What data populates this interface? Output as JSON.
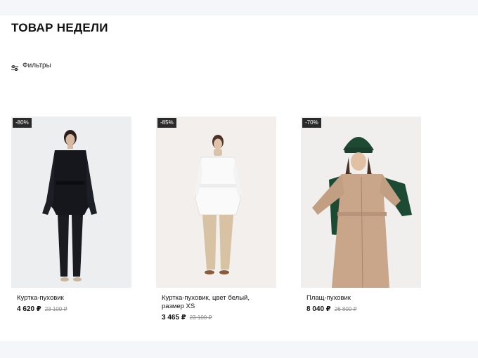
{
  "page": {
    "title": "ТОВАР НЕДЕЛИ"
  },
  "filters": {
    "label": "Фильтры",
    "icon": "sliders-icon"
  },
  "products": [
    {
      "badge": "-80%",
      "name": "Куртка-пуховик",
      "price": "4 620 ₽",
      "old_price": "23 100 ₽",
      "image": "woman-black-puffer-jacket"
    },
    {
      "badge": "-85%",
      "name": "Куртка-пуховик, цвет белый, размер XS",
      "price": "3 465 ₽",
      "old_price": "23 100 ₽",
      "image": "woman-white-puffer-jacket"
    },
    {
      "badge": "-70%",
      "name": "Плащ-пуховик",
      "price": "8 040 ₽",
      "old_price": "26 800 ₽",
      "image": "woman-beige-coat-green-hat"
    }
  ],
  "colors": {
    "badge_bg": "#2a2a2a",
    "band_bg": "#f5f6fa"
  }
}
